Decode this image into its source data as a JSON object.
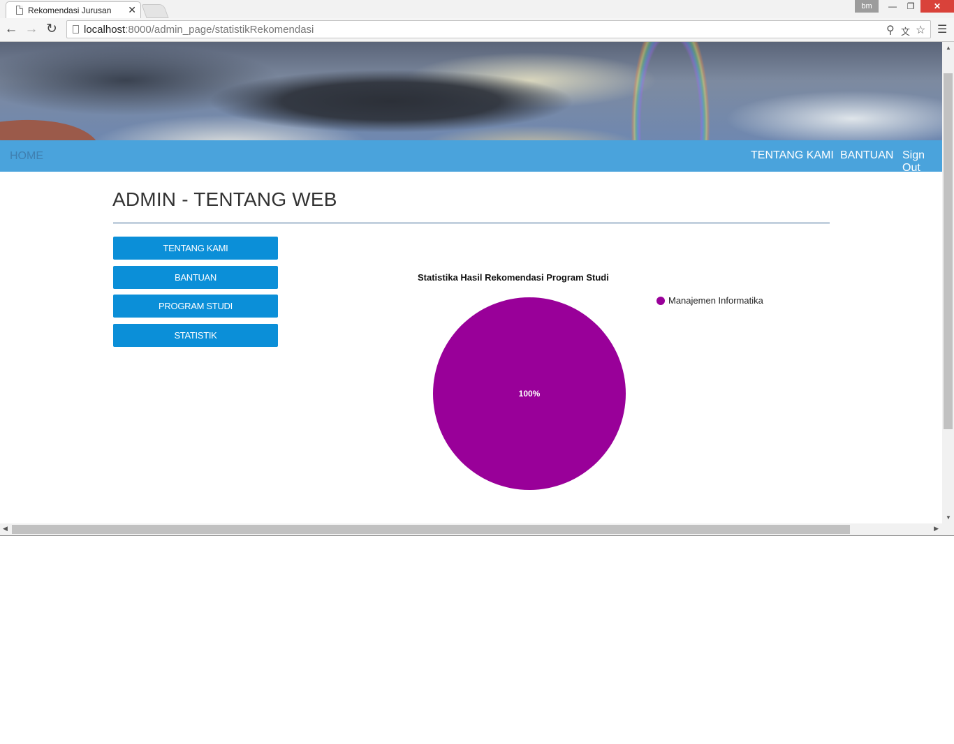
{
  "browser": {
    "tab_title": "Rekomendasi Jurusan",
    "tab_close": "✕",
    "profile": "bm",
    "url_host": "localhost",
    "url_rest": ":8000/admin_page/statistikRekomendasi",
    "icons": [
      "page-icon",
      "back-icon",
      "forward-icon",
      "reload-icon",
      "zoom-icon",
      "translate-icon",
      "star-icon",
      "menu-icon"
    ]
  },
  "navbar": {
    "home": "HOME",
    "tentang": "TENTANG KAMI",
    "bantuan": "BANTUAN",
    "signout": "Sign Out",
    "color": "#4aa3dc"
  },
  "page": {
    "title": "ADMIN - TENTANG WEB"
  },
  "sidebar": {
    "items": [
      {
        "label": "TENTANG KAMI"
      },
      {
        "label": "BANTUAN"
      },
      {
        "label": "PROGRAM STUDI"
      },
      {
        "label": "STATISTIK"
      }
    ],
    "button_color": "#0b8fd8"
  },
  "chart_data": {
    "type": "pie",
    "title": "Statistika Hasil Rekomendasi Program Studi",
    "slices": [
      {
        "label": "Manajemen Informatika",
        "value": 100,
        "percent_label": "100%",
        "color": "#990099"
      }
    ],
    "legend_position": "right"
  }
}
